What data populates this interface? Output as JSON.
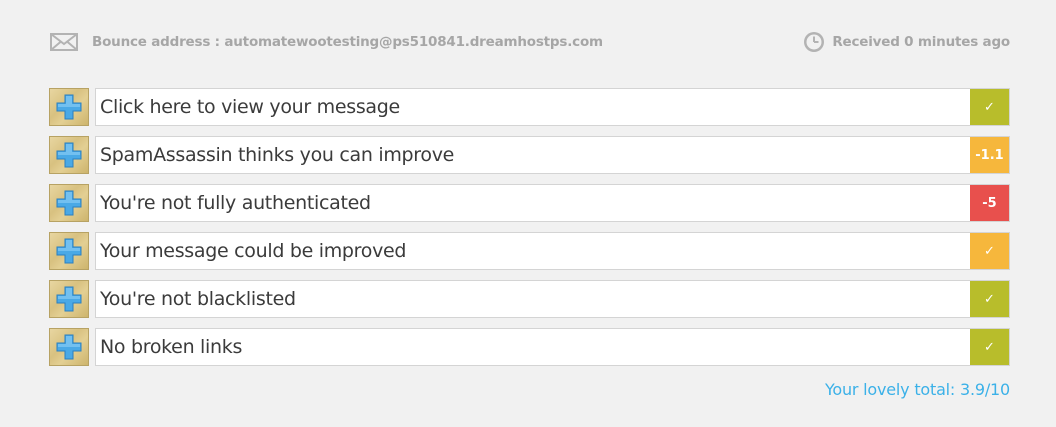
{
  "header": {
    "bounce_label": "Bounce address : automatewootesting@ps510841.dreamhostps.com",
    "received_label": "Received 0 minutes ago",
    "envelope_icon": "envelope-icon",
    "clock_icon": "clock-icon"
  },
  "colors": {
    "green": "#b8bd2b",
    "orange": "#f6b73c",
    "red": "#e8504d",
    "total_text": "#3bb1e8"
  },
  "results": [
    {
      "label": "Click here to view your message",
      "score": "✓",
      "status": "green"
    },
    {
      "label": "SpamAssassin thinks you can improve",
      "score": "-1.1",
      "status": "orange"
    },
    {
      "label": "You're not fully authenticated",
      "score": "-5",
      "status": "red"
    },
    {
      "label": "Your message could be improved",
      "score": "✓",
      "status": "orange"
    },
    {
      "label": "You're not blacklisted",
      "score": "✓",
      "status": "green"
    },
    {
      "label": "No broken links",
      "score": "✓",
      "status": "green"
    }
  ],
  "footer": {
    "total_label": "Your lovely total: 3.9/10"
  }
}
